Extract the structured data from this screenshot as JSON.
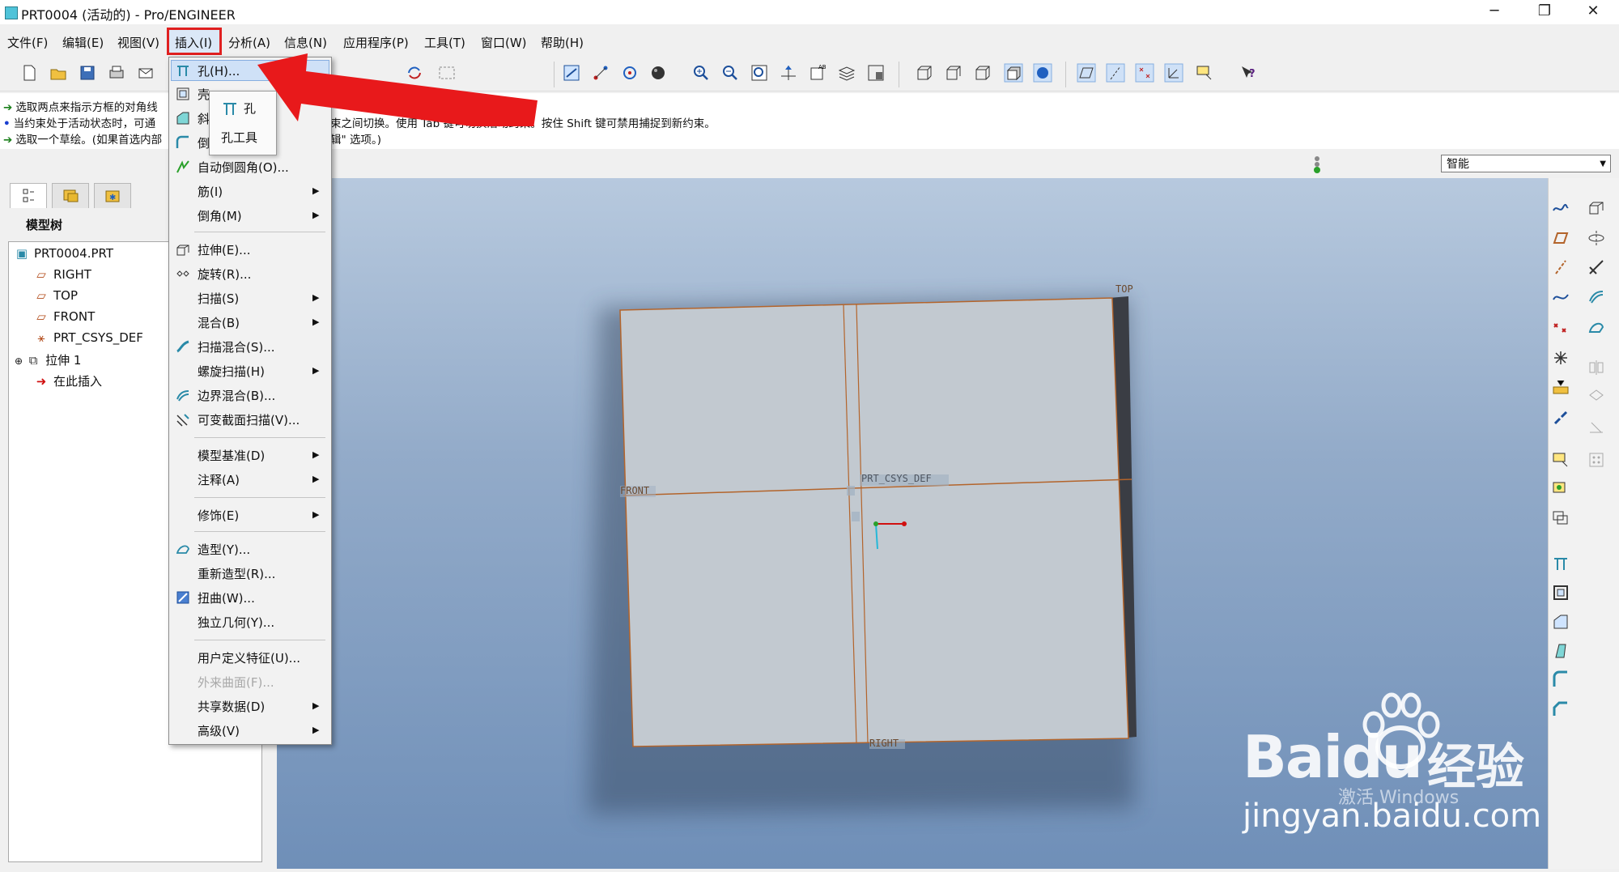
{
  "window": {
    "title": "PRT0004 (活动的) - Pro/ENGINEER",
    "minimize": "─",
    "restore": "❐",
    "close": "✕"
  },
  "menubar": [
    "文件(F)",
    "编辑(E)",
    "视图(V)",
    "插入(I)",
    "分析(A)",
    "信息(N)",
    "应用程序(P)",
    "工具(T)",
    "窗口(W)",
    "帮助(H)"
  ],
  "messages": [
    "选取两点来指示方框的对角线",
    "当约束处于活动状态时，可通",
    "束之间切换。使用 Tab 键可切换活动约束。按住 Shift 键可禁用捕捉到新约束。",
    "选取一个草绘。(如果首选内部",
    "辑\" 选项。)"
  ],
  "filter": {
    "value": "智能"
  },
  "model_tree": {
    "title": "模型树",
    "items": [
      "PRT0004.PRT",
      "RIGHT",
      "TOP",
      "FRONT",
      "PRT_CSYS_DEF",
      "拉伸 1",
      "在此插入"
    ],
    "expander": "⊕"
  },
  "insert_menu": {
    "items": [
      {
        "label": "孔(H)..."
      },
      {
        "label": "壳"
      },
      {
        "label": "斜"
      },
      {
        "label": "倒"
      },
      {
        "label": "自动倒圆角(O)..."
      },
      {
        "label": "筋(I)"
      },
      {
        "label": "倒角(M)"
      },
      {
        "label": "拉伸(E)..."
      },
      {
        "label": "旋转(R)..."
      },
      {
        "label": "扫描(S)"
      },
      {
        "label": "混合(B)"
      },
      {
        "label": "扫描混合(S)..."
      },
      {
        "label": "螺旋扫描(H)"
      },
      {
        "label": "边界混合(B)..."
      },
      {
        "label": "可变截面扫描(V)..."
      },
      {
        "label": "模型基准(D)"
      },
      {
        "label": "注释(A)"
      },
      {
        "label": "修饰(E)"
      },
      {
        "label": "造型(Y)..."
      },
      {
        "label": "重新造型(R)..."
      },
      {
        "label": "扭曲(W)..."
      },
      {
        "label": "独立几何(Y)..."
      },
      {
        "label": "用户定义特征(U)..."
      },
      {
        "label": "外来曲面(F)..."
      },
      {
        "label": "共享数据(D)"
      },
      {
        "label": "高级(V)"
      }
    ],
    "submenu_arrow": "▶"
  },
  "hole_popup": {
    "title": "孔",
    "subtitle": "孔工具"
  },
  "viewport_labels": {
    "top": "TOP",
    "front": "FRONT",
    "right": "RIGHT",
    "csys": "PRT_CSYS_DEF"
  },
  "watermark": {
    "brand": "Baidu",
    "jingyan": "经验",
    "url": "jingyan.baidu.com",
    "activate": "激活 Windows"
  },
  "colors": {
    "menu_highlight_border": "#e02020",
    "arrow_red": "#e8191b",
    "datum_orange": "#b3642b",
    "hover_blue": "#cfe1f7"
  }
}
